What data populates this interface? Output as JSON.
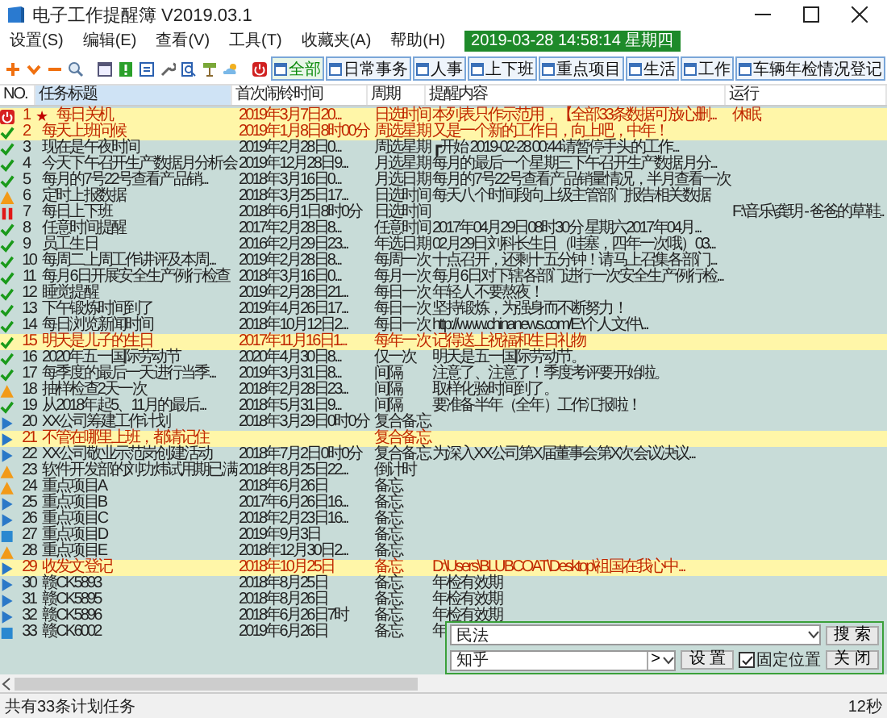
{
  "window": {
    "title": "电子工作提醒簿 V2019.03.1"
  },
  "menu": [
    "设置(S)",
    "编辑(E)",
    "查看(V)",
    "工具(T)",
    "收藏夹(A)",
    "帮助(H)"
  ],
  "clock": "2019-03-28 14:58:14 星期四",
  "tabs": [
    {
      "label": "全部",
      "selected": true
    },
    {
      "label": "日常事务",
      "selected": false
    },
    {
      "label": "人事",
      "selected": false
    },
    {
      "label": "上下班",
      "selected": false
    },
    {
      "label": "重点项目",
      "selected": false
    },
    {
      "label": "生活",
      "selected": false
    },
    {
      "label": "工作",
      "selected": false
    },
    {
      "label": "车辆年检情况登记",
      "selected": false
    }
  ],
  "table": {
    "columns": [
      "NO.",
      "任务标题",
      "首次闹铃时间",
      "周期",
      "提醒内容",
      "运行"
    ],
    "rows": [
      {
        "kind": "power",
        "no": "1",
        "star": "★",
        "title": "每日关机",
        "time": "2019年3月7日20...",
        "period": "日选时间",
        "content": "本列表只作示范用，【全部33条数据可放心删...",
        "run": "休眠",
        "highlighted": true
      },
      {
        "kind": "check",
        "no": "2",
        "title": "每天上班问候",
        "time": "2019年1月8日8时00分",
        "period": "周选星期",
        "content": "又是一个新的工作日，向上吧，中年！",
        "highlighted": true
      },
      {
        "kind": "check",
        "no": "3",
        "title": "现在是午夜时间",
        "time": "2019年2月28日0...",
        "period": "周选星期",
        "content": "┏开始 2019-02-28 00:44请暂停手头的工作...",
        "highlighted": false
      },
      {
        "kind": "check",
        "no": "4",
        "title": "今天下午召开生产数据月分析会",
        "time": "2019年12月28日9...",
        "period": "月选星期",
        "content": "每月的最后一个星期三下午召开生产数据月分...",
        "highlighted": false
      },
      {
        "kind": "check",
        "no": "5",
        "title": "每月的7号22号查看产品销...",
        "time": "2018年3月16日0...",
        "period": "月选日期",
        "content": "每月的7号22号查看产品销量情况，半月查看一次",
        "highlighted": false
      },
      {
        "kind": "warning",
        "no": "6",
        "title": "定时上报数据",
        "time": "2018年3月25日17...",
        "period": "日选时间",
        "content": "每天八个时间段向上级主管部门报告相关数据",
        "highlighted": false
      },
      {
        "kind": "pause",
        "no": "7",
        "title": "每日上下班",
        "time": "2018年6月1日8时0分",
        "period": "日选时间",
        "run": "F:\\音乐\\龚玥 - 爸爸的草鞋..",
        "highlighted": false
      },
      {
        "kind": "check",
        "no": "8",
        "title": "任意时间提醒",
        "time": "2017年2月28日8...",
        "period": "任意时间",
        "content": "2017年04月29日08时30分 星期六2017年04月...",
        "highlighted": false
      },
      {
        "kind": "check",
        "no": "9",
        "title": "员工生日",
        "time": "2016年2月29日23...",
        "period": "年选日期",
        "content": "02月29日刘科长生日（哇塞，四年一次哦）03...",
        "highlighted": false
      },
      {
        "kind": "check",
        "no": "10",
        "title": "每周二上周工作讲评及本周...",
        "time": "2019年2月28日8...",
        "period": "每周一次",
        "content": "十点召开，还剩十五分钟！请马上召集各部门...",
        "highlighted": false
      },
      {
        "kind": "check",
        "no": "11",
        "title": "每月6日开展安全生产例行检查",
        "time": "2018年3月16日0...",
        "period": "每月一次",
        "content": "每月6日对下辖各部门进行一次安全生产例行检...",
        "highlighted": false
      },
      {
        "kind": "check",
        "no": "12",
        "title": "睡觉提醒",
        "time": "2019年2月28日21...",
        "period": "每日一次",
        "content": "年轻人不要熬夜！",
        "highlighted": false
      },
      {
        "kind": "check",
        "no": "13",
        "title": "下午锻炼时间到了",
        "time": "2019年4月26日17...",
        "period": "每日一次",
        "content": "坚持锻炼，为强身而不断努力！",
        "highlighted": false
      },
      {
        "kind": "check",
        "no": "14",
        "title": "每日浏览新闻时间",
        "time": "2018年10月12日2...",
        "period": "每日一次",
        "content": "http://www.chinanews.com/E:\\个人文件\\...",
        "highlighted": false
      },
      {
        "kind": "check",
        "no": "15",
        "title": "明天是儿子的生日",
        "time": "2017年11月16日1...",
        "period": "每年一次",
        "content": "记得送上祝福和生日礼物",
        "highlighted": true
      },
      {
        "kind": "check",
        "no": "16",
        "title": "2020年五一国际劳动节",
        "time": "2020年4月30日8...",
        "period": "仅一次",
        "content": "明天是五一国际劳动节。",
        "highlighted": false
      },
      {
        "kind": "check",
        "no": "17",
        "title": "每季度的最后一天进行当季...",
        "time": "2019年3月31日8...",
        "period": "间隔",
        "content": "注意了、注意了！季度考评要开始啦。",
        "highlighted": false
      },
      {
        "kind": "warning",
        "no": "18",
        "title": "抽样检查2天一次",
        "time": "2018年2月28日23...",
        "period": "间隔",
        "content": "取样化验时间到了。",
        "highlighted": false
      },
      {
        "kind": "check",
        "no": "19",
        "title": "从2018年起5、11月的最后...",
        "time": "2018年5月31日9...",
        "period": "间隔",
        "content": "要准备半年（全年）工作汇报啦！",
        "highlighted": false
      },
      {
        "kind": "play",
        "no": "20",
        "title": "XX公司筹建工作计划",
        "time": "2018年3月29日0时0分",
        "period": "复合备忘",
        "highlighted": false
      },
      {
        "kind": "play",
        "no": "21",
        "title": "不管在哪里上班，都请记住",
        "period": "复合备忘",
        "highlighted": true
      },
      {
        "kind": "play",
        "no": "22",
        "title": "XX公司敬业示范岗创建活动",
        "time": "2018年7月2日0时0分",
        "period": "复合备忘",
        "content": "为深入XX公司第X届董事会第X次会议决议...",
        "highlighted": false
      },
      {
        "kind": "warning",
        "no": "23",
        "title": "软件开发部的刘功炜试用期已满",
        "time": "2018年8月25日22...",
        "period": "倒计时",
        "highlighted": false
      },
      {
        "kind": "warning",
        "no": "24",
        "title": "重点项目A",
        "time": "2018年6月26日",
        "period": "备忘",
        "highlighted": false
      },
      {
        "kind": "play",
        "no": "25",
        "title": "重点项目B",
        "time": "2017年6月26日16...",
        "period": "备忘",
        "highlighted": false
      },
      {
        "kind": "play",
        "no": "26",
        "title": "重点项目C",
        "time": "2018年2月23日16...",
        "period": "备忘",
        "highlighted": false
      },
      {
        "kind": "stop",
        "no": "27",
        "title": "重点项目D",
        "time": "2019年9月3日",
        "period": "备忘",
        "highlighted": false
      },
      {
        "kind": "warning",
        "no": "28",
        "title": "重点项目E",
        "time": "2018年12月30日2...",
        "period": "备忘",
        "highlighted": false
      },
      {
        "kind": "play",
        "no": "29",
        "title": "收发文登记",
        "time": "2018年10月25日",
        "period": "备忘",
        "content": "D:\\Users\\BLUBCOAT\\Desktop\\祖国在我心中...",
        "highlighted": true
      },
      {
        "kind": "play",
        "no": "30",
        "title": "赣CK5893",
        "time": "2018年8月25日",
        "period": "备忘",
        "content": "年检有效期",
        "highlighted": false
      },
      {
        "kind": "play",
        "no": "31",
        "title": "赣CK5895",
        "time": "2018年8月26日",
        "period": "备忘",
        "content": "年检有效期",
        "highlighted": false
      },
      {
        "kind": "play",
        "no": "32",
        "title": "赣CK5896",
        "time": "2018年6月26日7时",
        "period": "备忘",
        "content": "年检有效期",
        "highlighted": false
      },
      {
        "kind": "stop",
        "no": "33",
        "title": "赣CK6002",
        "time": "2019年6月26日",
        "period": "备忘",
        "content": "年",
        "highlighted": false
      }
    ]
  },
  "search_panel": {
    "query": "民法",
    "search_button": "搜 索",
    "site": "知乎",
    "arrow": ">",
    "settings_button": "设 置",
    "pin": {
      "label": "固定位置",
      "checked": true
    },
    "close_button": "关 闭"
  },
  "status_bar": {
    "summary": "共有33条计划任务",
    "timer": "12秒"
  }
}
